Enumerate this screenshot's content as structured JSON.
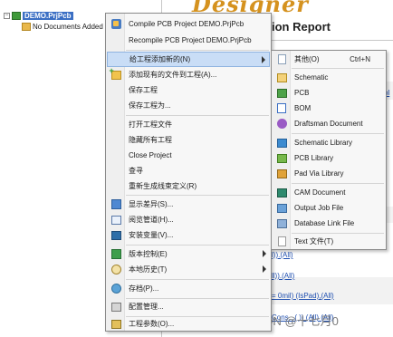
{
  "project_panel": {
    "project_name": "DEMO.PrjPcb",
    "no_docs_label": "No Documents Added"
  },
  "report": {
    "banner_text": "Designer",
    "title_text": "ion Report",
    "rows": [
      {
        "text": "bl"
      },
      {
        "text": "l)).(All)"
      },
      {
        "text": "ll)).(All)"
      },
      {
        "text": "= 0mil) (IsPad),(All)"
      },
      {
        "text": "Cons...( )) (All) (All)"
      }
    ],
    "watermark": "CSDN @十七月0"
  },
  "main_menu": {
    "items": [
      {
        "label": "Compile PCB Project DEMO.PrjPcb",
        "icon": "compile-icon"
      },
      {
        "label": "Recompile PCB Project DEMO.PrjPcb",
        "icon": ""
      },
      {
        "label": "给工程添加新的(N)",
        "icon": "",
        "submenu": true
      },
      {
        "label": "添加现有的文件到工程(A)...",
        "icon": "add-existing-icon"
      },
      {
        "label": "保存工程",
        "icon": ""
      },
      {
        "label": "保存工程为...",
        "icon": ""
      },
      {
        "label": "打开工程文件",
        "icon": ""
      },
      {
        "label": "隐藏所有工程",
        "icon": ""
      },
      {
        "label": "Close Project",
        "icon": ""
      },
      {
        "label": "查寻",
        "icon": ""
      },
      {
        "label": "重新生成线束定义(R)",
        "icon": ""
      },
      {
        "label": "显示差异(S)...",
        "icon": "diff-icon"
      },
      {
        "label": "阅览管道(H)...",
        "icon": "tree-icon"
      },
      {
        "label": "安装变量(V)...",
        "icon": "variant-icon"
      },
      {
        "label": "版本控制(E)",
        "icon": "vcs-icon",
        "submenu": true
      },
      {
        "label": "本地历史(T)",
        "icon": "history-icon",
        "submenu": true
      },
      {
        "label": "存档(P)...",
        "icon": "store-icon"
      },
      {
        "label": "配置管理...",
        "icon": "config-icon"
      },
      {
        "label": "工程参数(O)...",
        "icon": "parameters-icon"
      }
    ]
  },
  "sub_menu": {
    "items": [
      {
        "label": "其他(O)",
        "accel": "Ctrl+N",
        "icon": "doc-icon"
      },
      {
        "label": "Schematic",
        "accel": "",
        "icon": "schematic-icon"
      },
      {
        "label": "PCB",
        "accel": "",
        "icon": "pcb-icon"
      },
      {
        "label": "BOM",
        "accel": "",
        "icon": "bom-icon"
      },
      {
        "label": "Draftsman Document",
        "accel": "",
        "icon": "draftsman-icon"
      },
      {
        "label": "Schematic Library",
        "accel": "",
        "icon": "schematic-library-icon"
      },
      {
        "label": "PCB Library",
        "accel": "",
        "icon": "pcb-library-icon"
      },
      {
        "label": "Pad Via Library",
        "accel": "",
        "icon": "pad-via-library-icon"
      },
      {
        "label": "CAM Document",
        "accel": "",
        "icon": "cam-document-icon"
      },
      {
        "label": "Output Job File",
        "accel": "",
        "icon": "output-job-icon"
      },
      {
        "label": "Database Link File",
        "accel": "",
        "icon": "database-link-icon"
      },
      {
        "label": "Text 文件(T)",
        "accel": "",
        "icon": "text-file-icon"
      }
    ]
  }
}
